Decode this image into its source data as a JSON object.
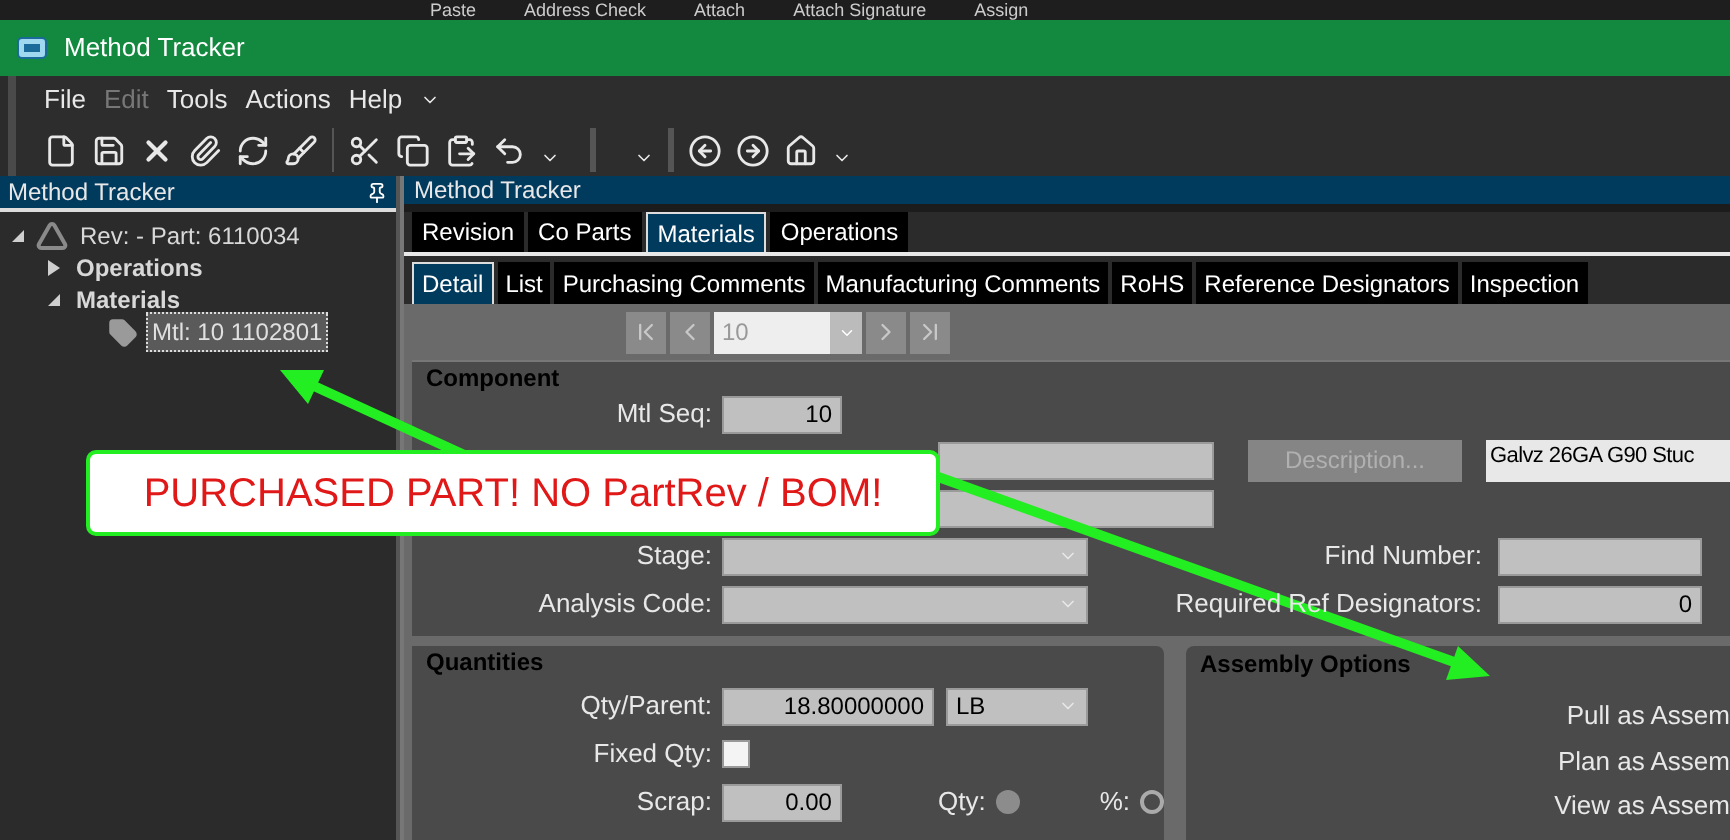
{
  "ribbon_remnant": [
    "Paste",
    "Address Check",
    "Attach",
    "Attach Signature",
    "Assign"
  ],
  "window": {
    "title": "Method Tracker"
  },
  "menu": [
    {
      "label": "File",
      "disabled": false
    },
    {
      "label": "Edit",
      "disabled": true
    },
    {
      "label": "Tools",
      "disabled": false
    },
    {
      "label": "Actions",
      "disabled": false
    },
    {
      "label": "Help",
      "disabled": false
    }
  ],
  "left_panel": {
    "title": "Method Tracker",
    "tree": [
      {
        "label": "Rev: - Part: 6110034",
        "kind": "revision",
        "expanded": true,
        "selected": false,
        "children": [
          {
            "label": "Operations",
            "kind": "folder",
            "expanded": false,
            "selected": false
          },
          {
            "label": "Materials",
            "kind": "folder",
            "expanded": true,
            "selected": false,
            "children": [
              {
                "label": "Mtl: 10 1102801",
                "kind": "material",
                "selected": true
              }
            ]
          }
        ]
      }
    ]
  },
  "main_panel": {
    "title": "Method Tracker",
    "tabs": [
      {
        "label": "Revision",
        "selected": false
      },
      {
        "label": "Co Parts",
        "selected": false
      },
      {
        "label": "Materials",
        "selected": true
      },
      {
        "label": "Operations",
        "selected": false
      }
    ],
    "subtabs": [
      {
        "label": "Detail",
        "selected": true
      },
      {
        "label": "List",
        "selected": false
      },
      {
        "label": "Purchasing Comments",
        "selected": false
      },
      {
        "label": "Manufacturing Comments",
        "selected": false
      },
      {
        "label": "RoHS",
        "selected": false
      },
      {
        "label": "Reference Designators",
        "selected": false
      },
      {
        "label": "Inspection",
        "selected": false
      }
    ],
    "navigator": {
      "value": "10"
    },
    "component": {
      "title": "Component",
      "mtl_seq": {
        "label": "Mtl Seq:",
        "value": "10"
      },
      "description_button": {
        "label": "Description...",
        "disabled": true
      },
      "description": "Galvz 26GA G90 Stuc",
      "stage": {
        "label": "Stage:"
      },
      "analysis_code": {
        "label": "Analysis Code:"
      },
      "find_number": {
        "label": "Find Number:"
      },
      "required_ref_designators": {
        "label": "Required Ref Designators:",
        "value": "0"
      }
    },
    "quantities": {
      "title": "Quantities",
      "qty_per_parent": {
        "label": "Qty/Parent:",
        "value": "18.80000000",
        "uom": "LB"
      },
      "fixed_qty": {
        "label": "Fixed Qty:",
        "checked": false
      },
      "scrap": {
        "label": "Scrap:",
        "value": "0.00"
      },
      "scrap_type": [
        {
          "label": "Qty:",
          "selected": true
        },
        {
          "label": "%:",
          "selected": false
        }
      ]
    },
    "assembly_options": {
      "title": "Assembly Options",
      "options": [
        "Pull as Assem",
        "Plan as Assem",
        "View as Assem"
      ]
    }
  },
  "annotation": {
    "callout": "PURCHASED PART! NO PartRev / BOM!"
  }
}
